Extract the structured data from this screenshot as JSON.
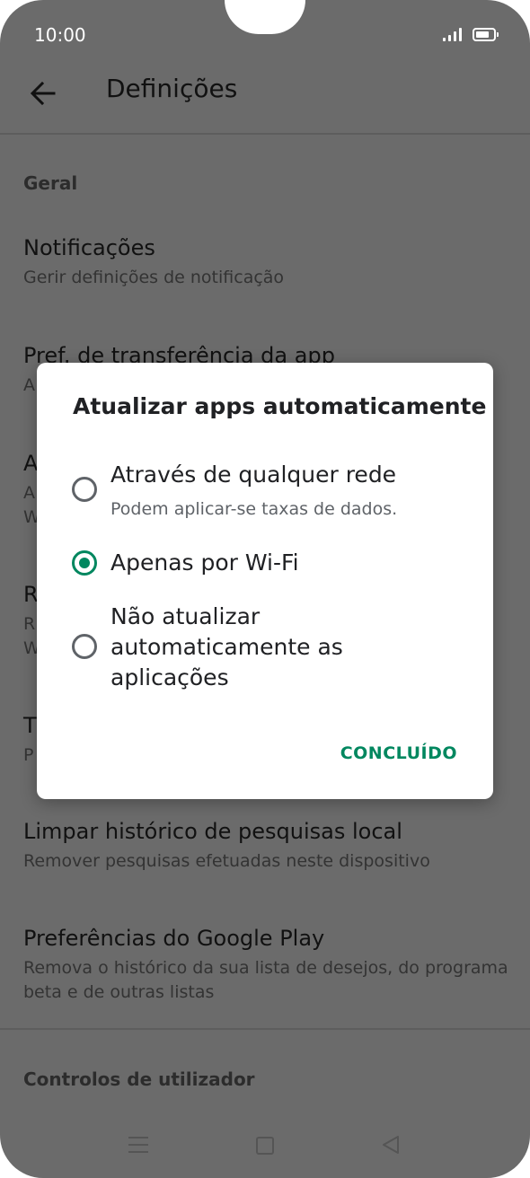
{
  "status_bar": {
    "time": "10:00"
  },
  "app_bar": {
    "title": "Definições"
  },
  "settings": {
    "section_general": "Geral",
    "items": [
      {
        "title": "Notificações",
        "subtitle": "Gerir definições de notificação"
      },
      {
        "title": "Pref. de transferência da app",
        "subtitle": "A"
      },
      {
        "title": "A",
        "subtitle": "A\nW"
      },
      {
        "title": "R",
        "subtitle": "R\nW"
      },
      {
        "title": "T",
        "subtitle": "P"
      },
      {
        "title": "Limpar histórico de pesquisas local",
        "subtitle": "Remover pesquisas efetuadas neste dispositivo"
      },
      {
        "title": "Preferências do Google Play",
        "subtitle": "Remova o histórico da sua lista de desejos, do programa beta e de outras listas"
      }
    ],
    "section_user_controls": "Controlos de utilizador"
  },
  "dialog": {
    "title": "Atualizar apps automaticamente",
    "options": [
      {
        "label": "Através de qualquer rede",
        "subtitle": "Podem aplicar-se taxas de dados.",
        "selected": false
      },
      {
        "label": "Apenas por Wi-Fi",
        "selected": true
      },
      {
        "label": "Não atualizar automaticamente as aplicações",
        "selected": false
      }
    ],
    "done_label": "CONCLUÍDO"
  },
  "colors": {
    "accent": "#01875f",
    "scrim_background": "#6b6b6b",
    "dialog_background": "#ffffff"
  }
}
